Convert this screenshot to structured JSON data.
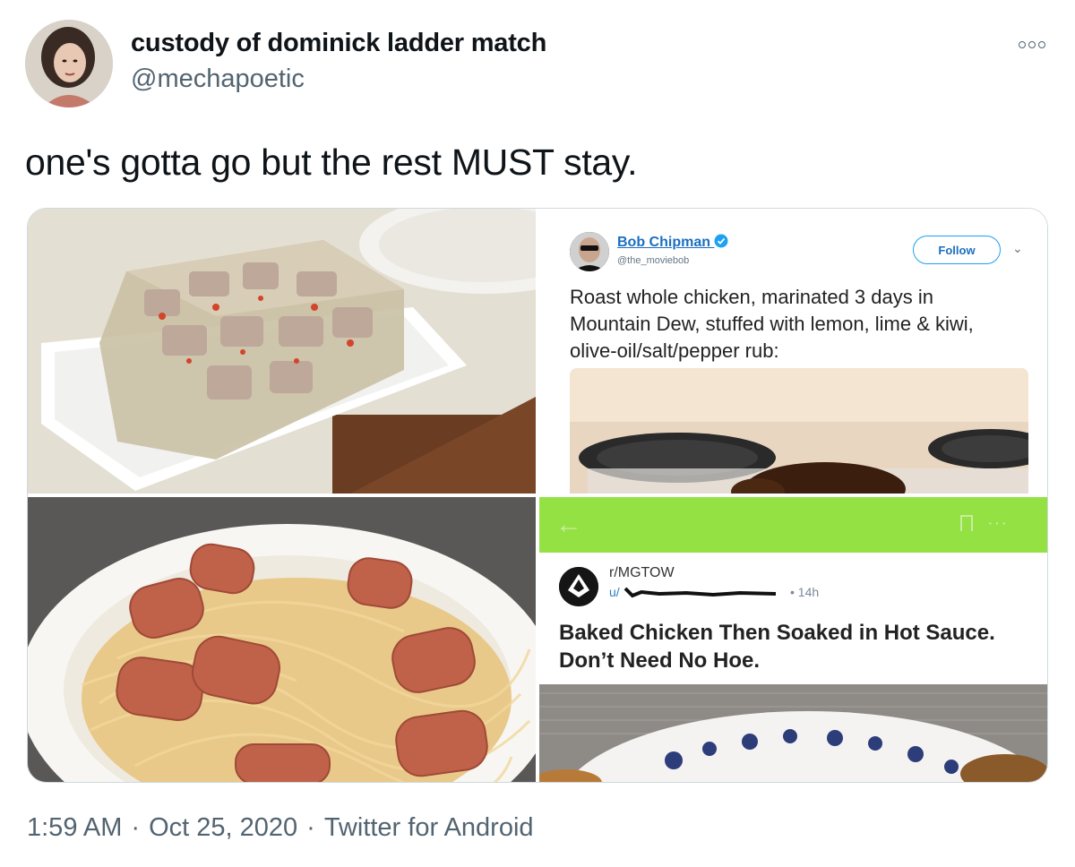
{
  "user": {
    "display_name": "custody of dominick ladder match",
    "handle": "@mechapoetic"
  },
  "tweet": {
    "text": "one's gotta go but the rest MUST stay."
  },
  "menu": {
    "icon": "more-options-icon"
  },
  "embedded_tweet": {
    "name": "Bob Chipman",
    "handle": "@the_moviebob",
    "verified_icon": "verified-badge-icon",
    "follow_label": "Follow",
    "text": "Roast whole chicken, marinated 3 days in Mountain Dew, stuffed with lemon, lime & kiwi, olive-oil/salt/pepper rub:"
  },
  "reddit_post": {
    "subreddit": "r/MGTOW",
    "user_prefix": "u/",
    "time": "• 14h",
    "title": "Baked Chicken Then Soaked in Hot Sauce. Don’t Need No Hoe.",
    "accent_color": "#94e143"
  },
  "footer": {
    "time": "1:59 AM",
    "date": "Oct 25, 2020",
    "source": "Twitter for Android",
    "separator": "·"
  }
}
